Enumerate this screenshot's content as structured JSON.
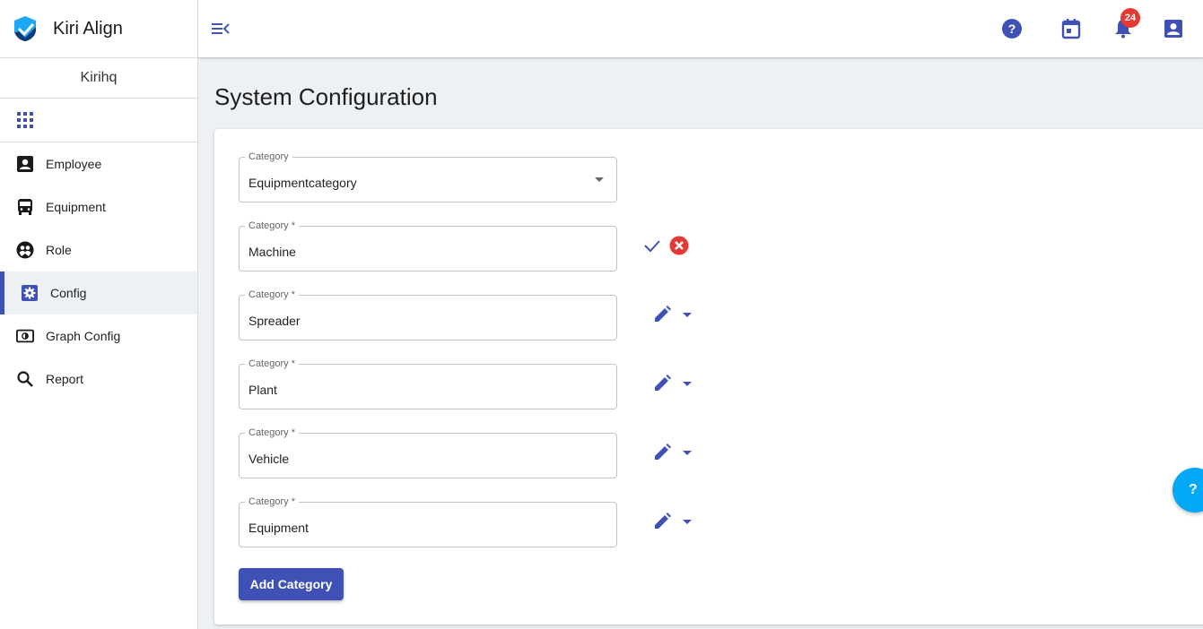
{
  "app": {
    "name": "Kiri Align",
    "organization": "Kirihq"
  },
  "colors": {
    "primary": "#3f51b5",
    "danger": "#e53935",
    "help": "#03a9f4",
    "logo_light": "#1ea7f5",
    "logo_dark": "#0d3b7a"
  },
  "sidebar": {
    "apps_icon": "grid-icon",
    "items": [
      {
        "label": "Employee",
        "icon": "account-box-icon",
        "active": false
      },
      {
        "label": "Equipment",
        "icon": "bus-icon",
        "active": false
      },
      {
        "label": "Role",
        "icon": "role-icon",
        "active": false
      },
      {
        "label": "Config",
        "icon": "settings-box-icon",
        "active": true
      },
      {
        "label": "Graph Config",
        "icon": "contrast-box-icon",
        "active": false
      },
      {
        "label": "Report",
        "icon": "search-icon",
        "active": false
      }
    ]
  },
  "topbar": {
    "menu_icon": "menu-collapse-icon",
    "help_icon": "help-circle-icon",
    "calendar_icon": "calendar-icon",
    "notifications_icon": "bell-icon",
    "notifications_count": "24",
    "profile_icon": "account-box-icon"
  },
  "page": {
    "title": "System Configuration"
  },
  "form": {
    "selector": {
      "label": "Category",
      "value": "Equipmentcategory"
    },
    "categories": [
      {
        "label": "Category *",
        "value": "Machine",
        "mode": "editing"
      },
      {
        "label": "Category *",
        "value": "Spreader",
        "mode": "view"
      },
      {
        "label": "Category *",
        "value": "Plant",
        "mode": "view"
      },
      {
        "label": "Category *",
        "value": "Vehicle",
        "mode": "view"
      },
      {
        "label": "Category *",
        "value": "Equipment",
        "mode": "view"
      }
    ],
    "add_button_label": "Add Category"
  },
  "help_fab": {
    "label": "?"
  }
}
